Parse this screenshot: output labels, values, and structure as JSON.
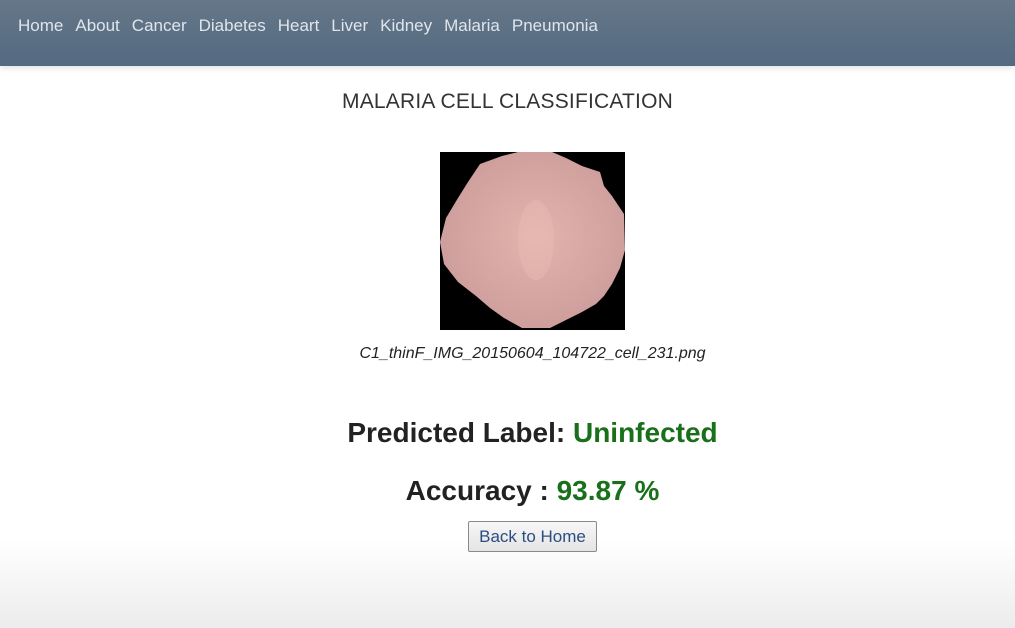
{
  "nav": {
    "items": [
      {
        "label": "Home"
      },
      {
        "label": "About"
      },
      {
        "label": "Cancer"
      },
      {
        "label": "Diabetes"
      },
      {
        "label": "Heart"
      },
      {
        "label": "Liver"
      },
      {
        "label": "Kidney"
      },
      {
        "label": "Malaria"
      },
      {
        "label": "Pneumonia"
      }
    ]
  },
  "page": {
    "title": "MALARIA CELL CLASSIFICATION",
    "image_filename": "C1_thinF_IMG_20150604_104722_cell_231.png"
  },
  "result": {
    "predicted_label_text": "Predicted Label:",
    "predicted_label_value": "Uninfected",
    "accuracy_text": "Accuracy :",
    "accuracy_value": "93.87 %"
  },
  "buttons": {
    "back_label": "Back to Home"
  },
  "colors": {
    "navbar": "#5a6f84",
    "nav_text": "#dfe5ec",
    "result_green": "#1a6f1a",
    "button_text": "#2b4d82"
  }
}
